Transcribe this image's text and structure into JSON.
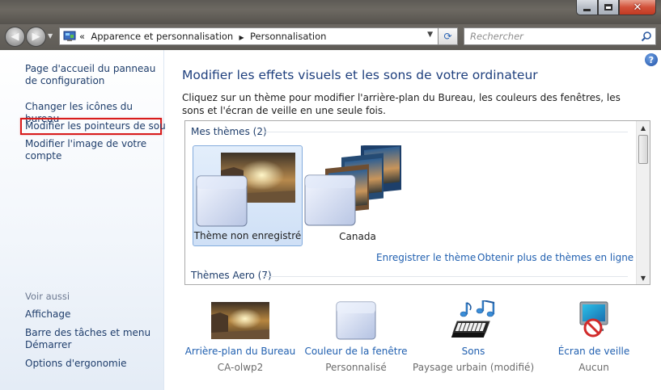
{
  "window": {
    "min_icon": "minimize-icon",
    "max_icon": "maximize-icon",
    "close_icon": "close-icon"
  },
  "nav": {
    "breadcrumb_sep_start": "«",
    "breadcrumb": [
      "Apparence et personnalisation",
      "Personnalisation"
    ],
    "search_placeholder": "Rechercher"
  },
  "sidebar": {
    "links": [
      {
        "label": "Page d'accueil du panneau de configuration"
      },
      {
        "label": "Changer les icônes du bureau"
      },
      {
        "label": "Modifier les pointeurs de souris",
        "highlighted": true
      },
      {
        "label": "Modifier l'image de votre compte"
      }
    ],
    "see_also_title": "Voir aussi",
    "see_also": [
      {
        "label": "Affichage"
      },
      {
        "label": "Barre des tâches et menu Démarrer"
      },
      {
        "label": "Options d'ergonomie"
      }
    ]
  },
  "main": {
    "title": "Modifier les effets visuels et les sons de votre ordinateur",
    "description": "Cliquez sur un thème pour modifier l'arrière-plan du Bureau, les couleurs des fenêtres, les sons et l'écran de veille en une seule fois.",
    "my_themes_label": "Mes thèmes (2)",
    "themes": [
      {
        "name": "Thème non enregistré",
        "selected": true
      },
      {
        "name": "Canada",
        "selected": false
      }
    ],
    "save_theme": "Enregistrer le thème",
    "more_themes": "Obtenir plus de thèmes en ligne",
    "aero_label": "Thèmes Aero (7)",
    "bottom": [
      {
        "label": "Arrière-plan du Bureau",
        "value": "CA-olwp2",
        "icon": "desktop-background-icon"
      },
      {
        "label": "Couleur de la fenêtre",
        "value": "Personnalisé",
        "icon": "window-color-icon"
      },
      {
        "label": "Sons",
        "value": "Paysage urbain (modifié)",
        "icon": "sounds-icon"
      },
      {
        "label": "Écran de veille",
        "value": "Aucun",
        "icon": "screensaver-icon"
      }
    ]
  },
  "colors": {
    "link": "#2160b0",
    "title": "#1e3f7d",
    "highlight_border": "#d81c1c",
    "selection": "#cfe0f6"
  }
}
